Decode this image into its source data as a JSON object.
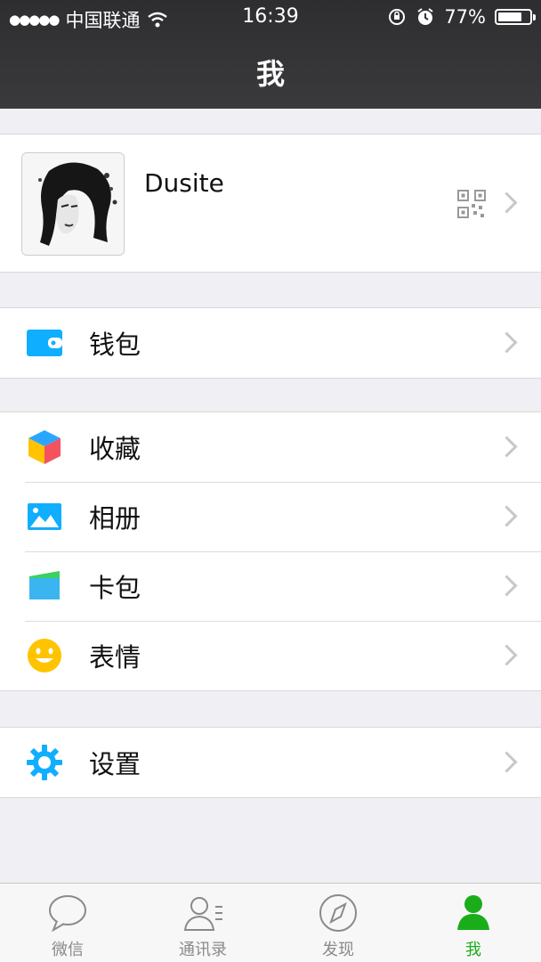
{
  "status": {
    "signal_dots": "●●●●●",
    "carrier": "中国联通",
    "time": "16:39",
    "battery": "77%",
    "battery_level": 0.77
  },
  "header": {
    "title": "我"
  },
  "profile": {
    "name": "Dusite"
  },
  "menu": {
    "wallet": "钱包",
    "favorites": "收藏",
    "album": "相册",
    "cards": "卡包",
    "stickers": "表情",
    "settings": "设置"
  },
  "tabs": [
    {
      "label": "微信",
      "icon": "chat-icon"
    },
    {
      "label": "通讯录",
      "icon": "contacts-icon"
    },
    {
      "label": "发现",
      "icon": "compass-icon"
    },
    {
      "label": "我",
      "icon": "me-icon",
      "active": true
    }
  ],
  "colors": {
    "accent": "#1aad19",
    "blue": "#10aeff",
    "background": "#efeff4"
  }
}
